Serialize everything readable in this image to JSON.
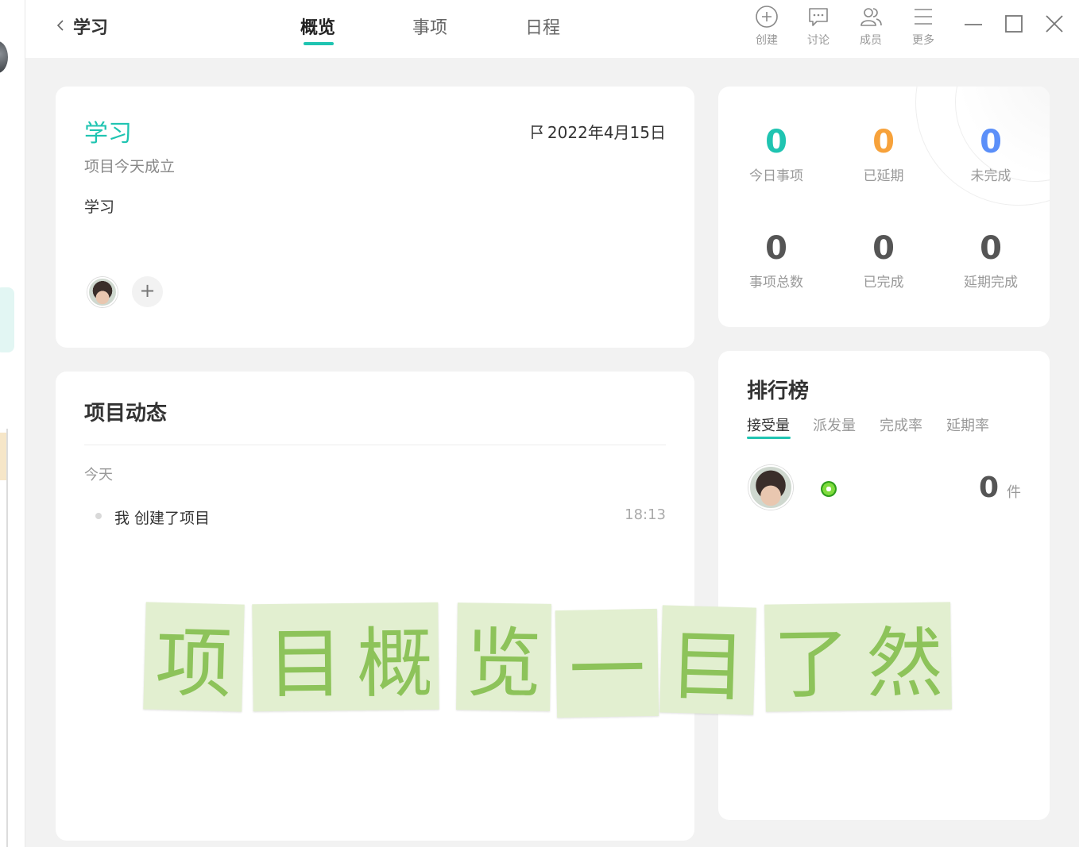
{
  "header": {
    "project_name": "学习",
    "tabs": [
      {
        "label": "概览",
        "active": true
      },
      {
        "label": "事项",
        "active": false
      },
      {
        "label": "日程",
        "active": false
      }
    ],
    "tools": [
      {
        "icon": "plus-circle-icon",
        "label": "创建"
      },
      {
        "icon": "chat-icon",
        "label": "讨论"
      },
      {
        "icon": "members-icon",
        "label": "成员"
      },
      {
        "icon": "menu-icon",
        "label": "更多"
      }
    ],
    "window_controls": [
      "minimize-icon",
      "maximize-icon",
      "close-icon"
    ]
  },
  "project": {
    "title": "学习",
    "date": "2022年4月15日",
    "subtitle": "项目今天成立",
    "description": "学习",
    "add_label": "+"
  },
  "stats": {
    "row1": [
      {
        "value": "0",
        "label": "今日事项",
        "color": "#1fc4b1"
      },
      {
        "value": "0",
        "label": "已延期",
        "color": "#f7a23b"
      },
      {
        "value": "0",
        "label": "未完成",
        "color": "#5b8ff9"
      }
    ],
    "row2": [
      {
        "value": "0",
        "label": "事项总数",
        "color": "#555555"
      },
      {
        "value": "0",
        "label": "已完成",
        "color": "#555555"
      },
      {
        "value": "0",
        "label": "延期完成",
        "color": "#555555"
      }
    ]
  },
  "activity": {
    "title": "项目动态",
    "day": "今天",
    "items": [
      {
        "text": "我 创建了项目",
        "time": "18:13"
      }
    ]
  },
  "ranking": {
    "title": "排行榜",
    "tabs": [
      "接受量",
      "派发量",
      "完成率",
      "延期率"
    ],
    "active_tab": 0,
    "entries": [
      {
        "count": "0",
        "unit": "件"
      }
    ]
  },
  "banner": {
    "chars": [
      "项",
      "目",
      "概",
      "览",
      "一",
      "目",
      "了",
      "然"
    ]
  },
  "colors": {
    "accent": "#1fc4b1",
    "warning": "#f7a23b",
    "info": "#5b8ff9",
    "banner_bg": "#e2efd0",
    "banner_text": "#8dc35a"
  }
}
